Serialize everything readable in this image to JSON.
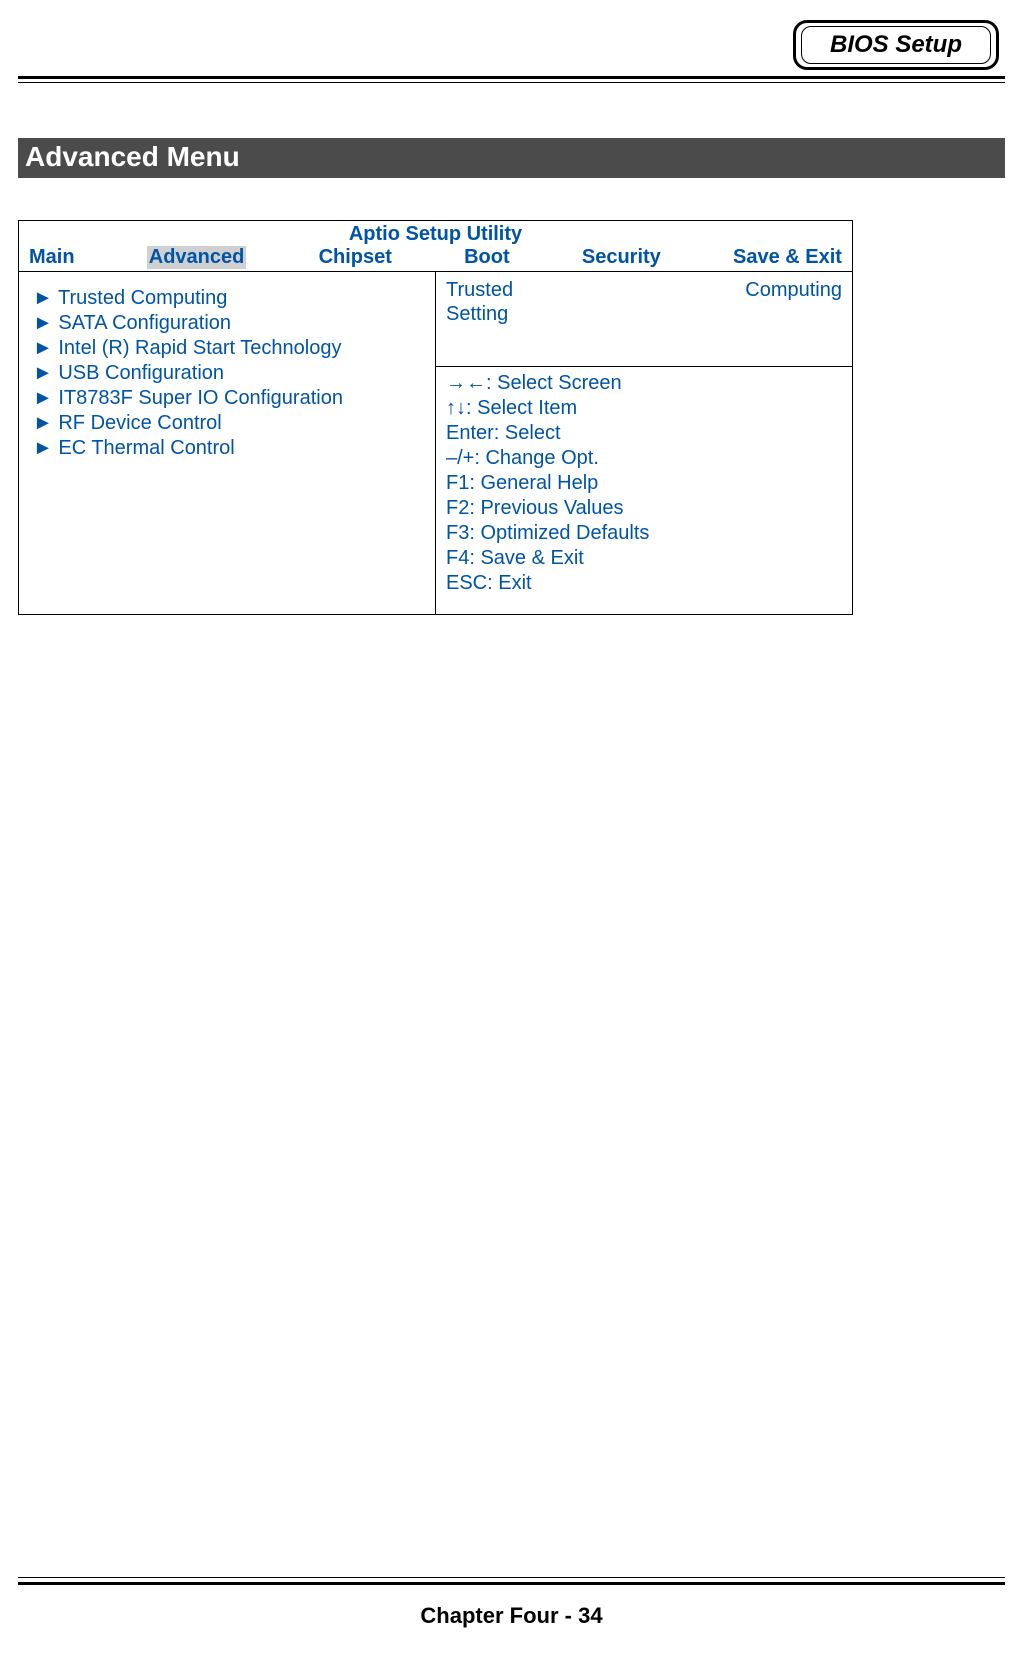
{
  "header": {
    "badge": "BIOS Setup"
  },
  "section_title": "Advanced Menu",
  "bios": {
    "utility_title": "Aptio Setup Utility",
    "tabs": {
      "main": "Main",
      "advanced": "Advanced",
      "chipset": "Chipset",
      "boot": "Boot",
      "security": "Security",
      "save_exit": "Save & Exit"
    },
    "menu_items": [
      "Trusted Computing",
      "SATA Configuration",
      "Intel (R) Rapid Start Technology",
      "USB Configuration",
      "IT8783F Super IO Configuration",
      "RF Device Control",
      "EC Thermal Control"
    ],
    "help": {
      "word1": "Trusted",
      "word2": "Computing",
      "word3": "Setting"
    },
    "nav": [
      "→←: Select Screen",
      "↑↓: Select Item",
      "Enter: Select",
      "–/+: Change Opt.",
      "F1: General Help",
      "F2: Previous Values",
      "F3: Optimized Defaults",
      "F4: Save & Exit",
      "ESC: Exit"
    ]
  },
  "footer": "Chapter Four - 34"
}
